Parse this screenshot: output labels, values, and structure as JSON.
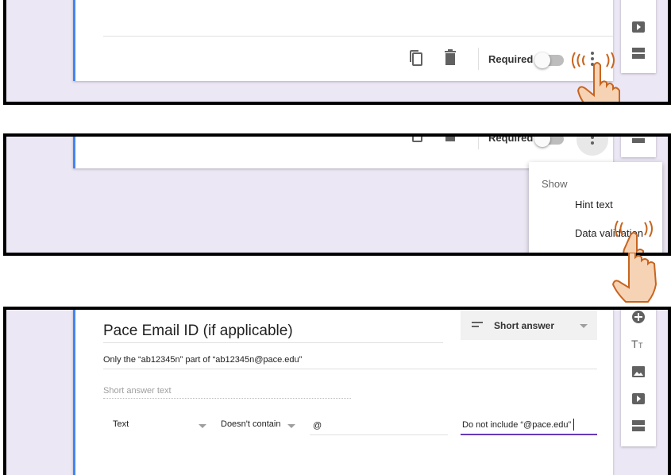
{
  "panel1": {
    "required_label": "Required"
  },
  "panel2": {
    "required_label": "Required",
    "menu": {
      "heading": "Show",
      "items": [
        "Hint text",
        "Data validation"
      ]
    }
  },
  "panel3": {
    "question_title": "Pace Email ID (if applicable)",
    "description": "Only the “ab12345n” part of “ab12345n@pace.edu”",
    "answer_placeholder": "Short answer text",
    "question_type": "Short answer",
    "validation": {
      "type": "Text",
      "condition": "Doesn't contain",
      "value": "@",
      "error_text": "Do not include “@pace.edu”"
    }
  },
  "colors": {
    "background": "#ece7f5",
    "accent": "#4285f4",
    "underline_active": "#673ab7",
    "hand_fill": "#f6d3b5",
    "hand_stroke": "#c8641e"
  },
  "icons": [
    "copy-icon",
    "delete-icon",
    "more-vert-icon",
    "video-icon",
    "section-icon",
    "add-icon",
    "title-icon",
    "image-icon",
    "pointing-hand-icon"
  ]
}
